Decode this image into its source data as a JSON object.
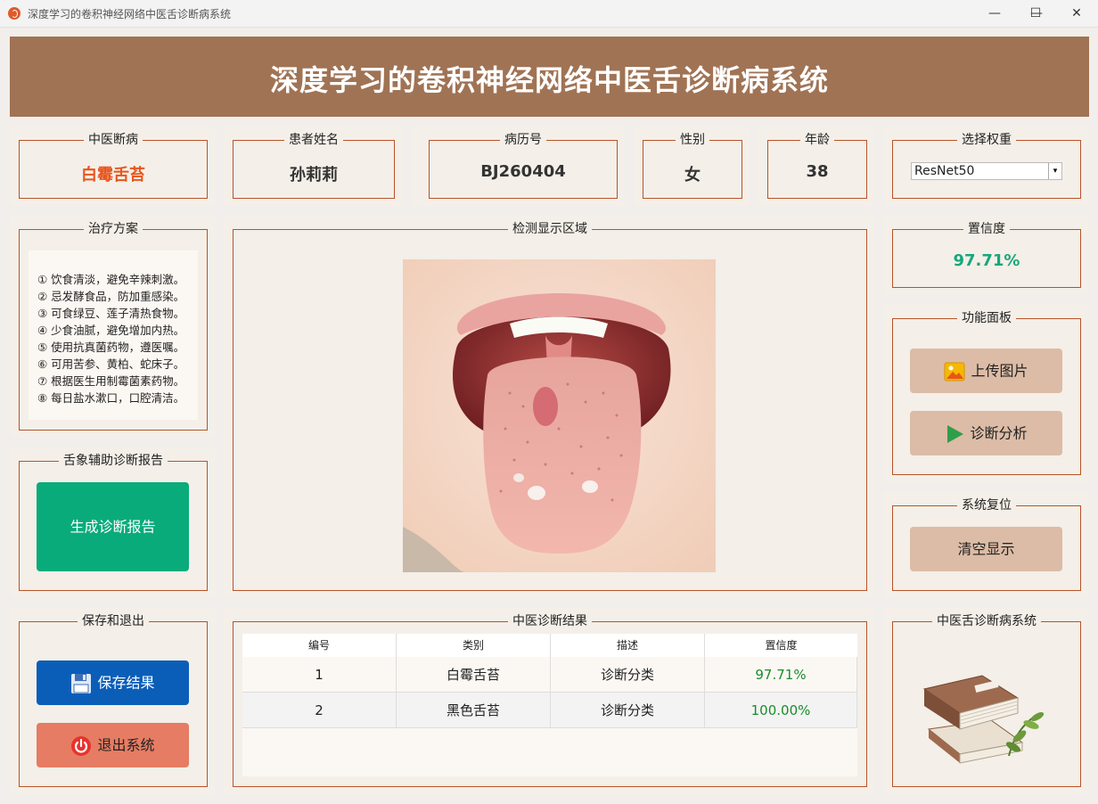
{
  "window": {
    "title": "深度学习的卷积神经网络中医舌诊断病系统",
    "minimize": "—",
    "maximize": "☐",
    "close": "✕"
  },
  "header": {
    "title": "深度学习的卷积神经网络中医舌诊断病系统"
  },
  "info": {
    "diagnosis": {
      "label": "中医断病",
      "value": "白霉舌苔"
    },
    "patient_name": {
      "label": "患者姓名",
      "value": "孙莉莉"
    },
    "record_no": {
      "label": "病历号",
      "value": "BJ260404"
    },
    "gender": {
      "label": "性别",
      "value": "女"
    },
    "age": {
      "label": "年龄",
      "value": "38"
    },
    "weights": {
      "label": "选择权重",
      "selected": "ResNet50",
      "arrow": "▾"
    }
  },
  "treatment": {
    "label": "治疗方案",
    "items": [
      "① 饮食清淡，避免辛辣刺激。",
      "② 忌发酵食品，防加重感染。",
      "③ 可食绿豆、莲子清热食物。",
      "④ 少食油腻，避免增加内热。",
      "⑤ 使用抗真菌药物，遵医嘱。",
      "⑥ 可用苦参、黄柏、蛇床子。",
      "⑦ 根据医生用制霉菌素药物。",
      "⑧ 每日盐水漱口，口腔清洁。"
    ]
  },
  "report": {
    "label": "舌象辅助诊断报告",
    "button": "生成诊断报告"
  },
  "save_exit": {
    "label": "保存和退出",
    "save": "保存结果",
    "exit": "退出系统"
  },
  "detection": {
    "label": "检测显示区域"
  },
  "confidence": {
    "label": "置信度",
    "value": "97.71%"
  },
  "functions": {
    "label": "功能面板",
    "upload": "上传图片",
    "analyze": "诊断分析"
  },
  "reset": {
    "label": "系统复位",
    "clear": "清空显示"
  },
  "results": {
    "label": "中医诊断结果",
    "headers": [
      "编号",
      "类别",
      "描述",
      "置信度"
    ],
    "rows": [
      [
        "1",
        "白霉舌苔",
        "诊断分类",
        "97.71%"
      ],
      [
        "2",
        "黑色舌苔",
        "诊断分类",
        "100.00%"
      ]
    ]
  },
  "brand": {
    "label": "中医舌诊断病系统"
  },
  "colors": {
    "header": "#a07354",
    "accent_orange": "#e8551c",
    "confidence_green": "#18a77c",
    "report_button": "#0aab7b",
    "save_button": "#0b5eb8",
    "exit_button": "#e57c63",
    "function_button": "#dcbca6",
    "border": "#b5542a"
  },
  "icons": {
    "upload": "image-icon",
    "analyze": "play-icon",
    "save": "floppy-disk-icon",
    "exit": "power-icon",
    "brand": "books-herb-icon"
  }
}
